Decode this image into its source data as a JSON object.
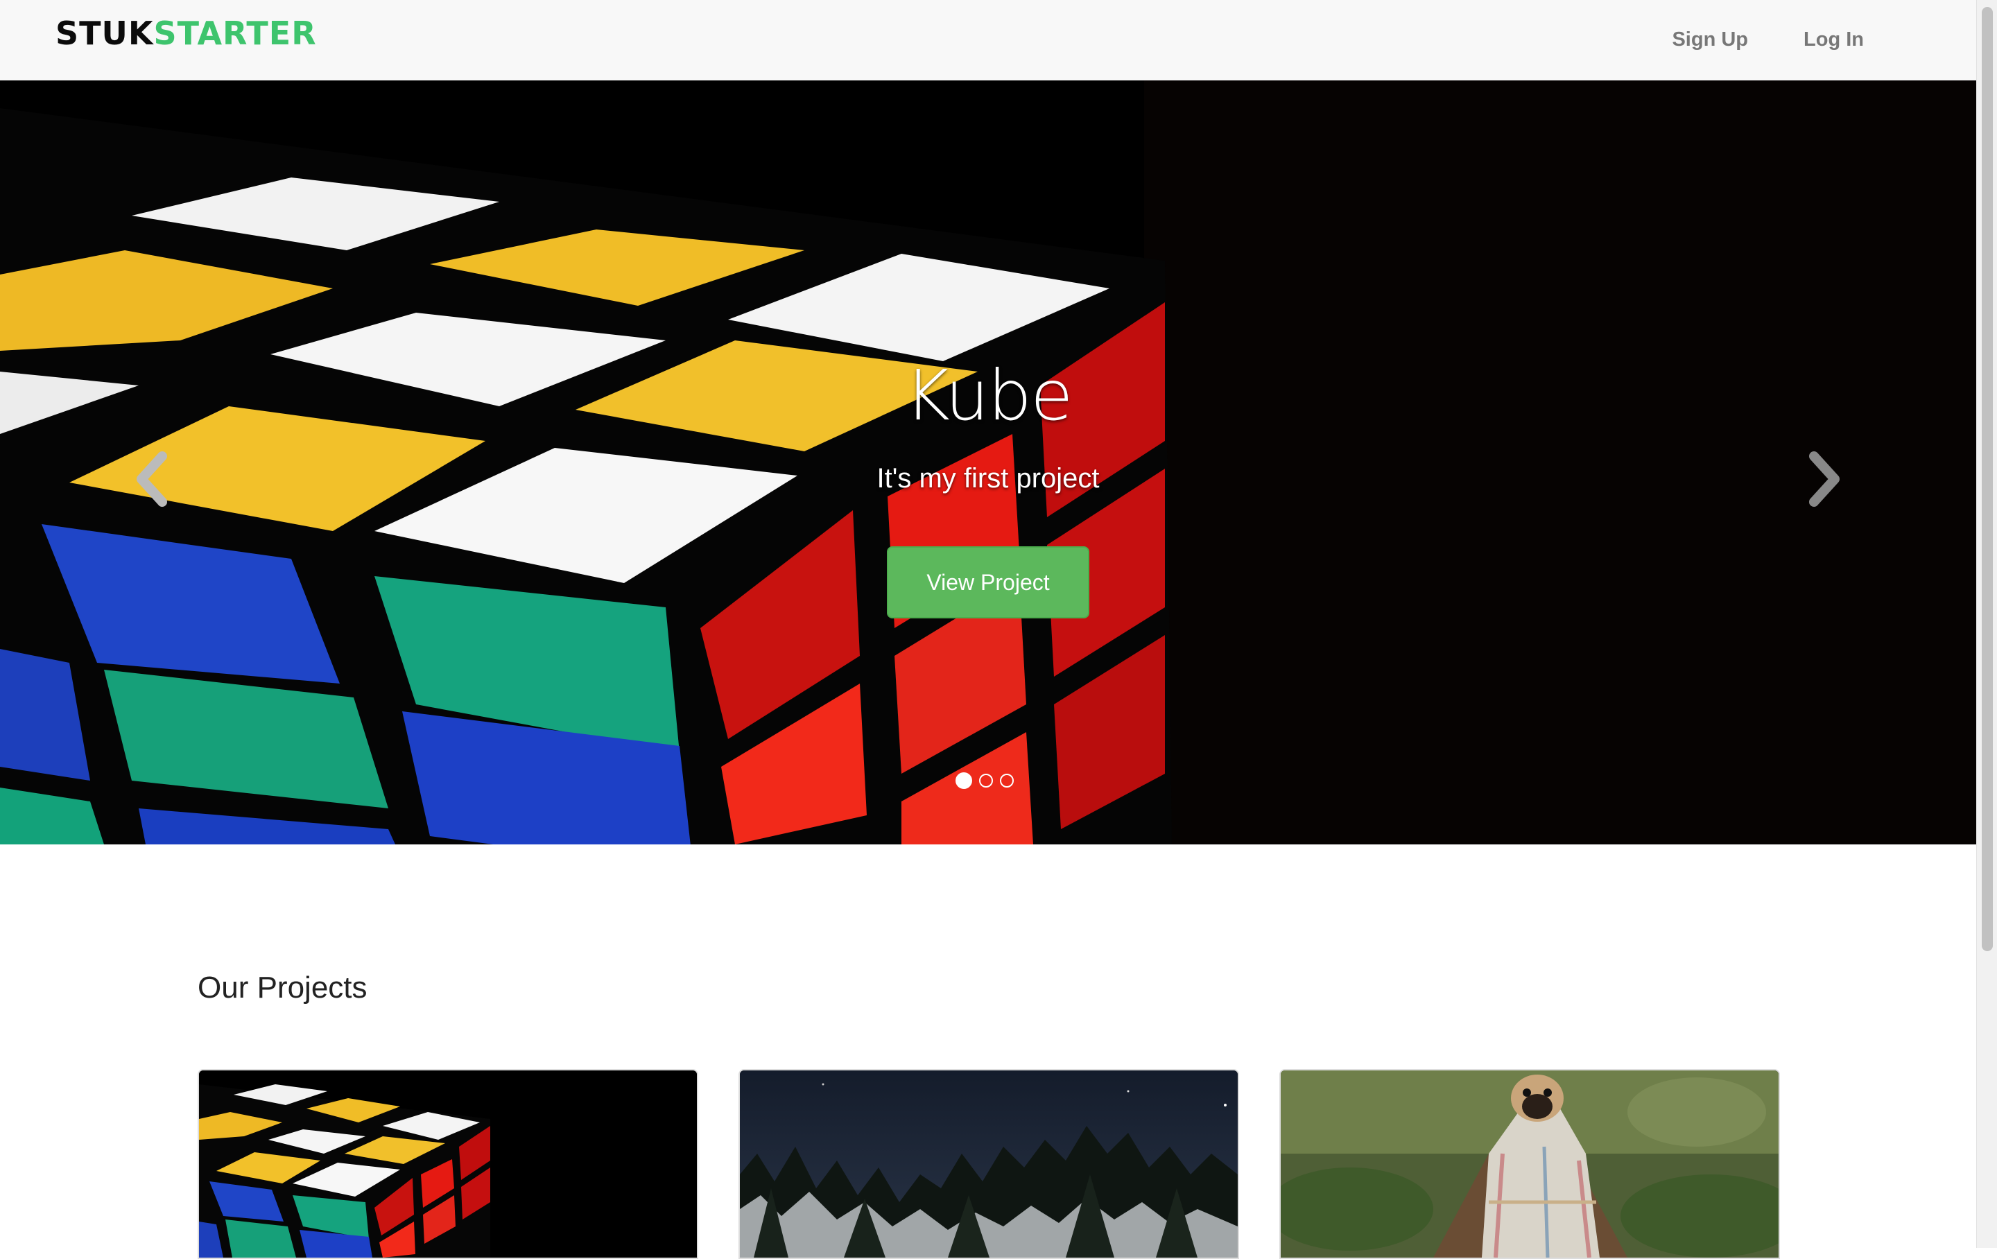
{
  "navbar": {
    "brand_part1": "STUK",
    "brand_part2": "STARTER",
    "links": [
      "Sign Up",
      "Log In"
    ]
  },
  "hero": {
    "title": "Kube",
    "subtitle": "It's my first project",
    "button": "View Project",
    "slides_count": 3,
    "active_slide": 1
  },
  "projects": {
    "heading": "Our Projects",
    "cards": [
      "rubiks-cube-image",
      "snowy-forest-image",
      "pug-in-blanket-image"
    ]
  },
  "colors": {
    "brand_green": "#3ec46d",
    "button_green": "#5cb85c"
  }
}
